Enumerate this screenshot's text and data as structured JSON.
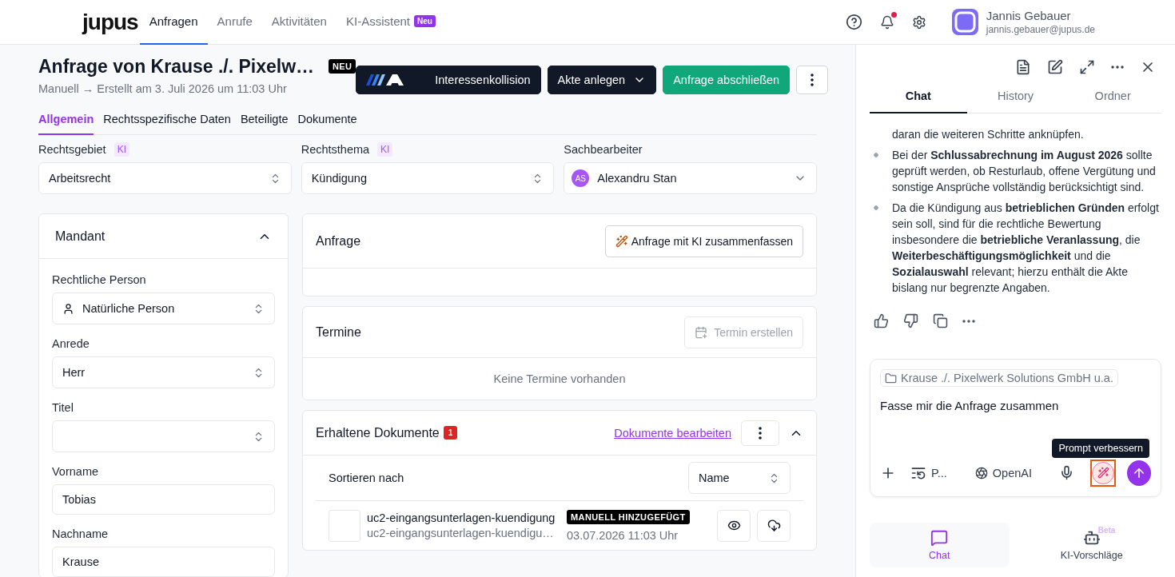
{
  "nav": {
    "logo": "jupus",
    "tabs": [
      {
        "label": "Anfragen",
        "selected": true
      },
      {
        "label": "Anrufe",
        "selected": false
      },
      {
        "label": "Aktivitäten",
        "selected": false
      },
      {
        "label": "KI-Assistent",
        "selected": false,
        "badge": "Neu"
      }
    ],
    "notifications_unread": true,
    "user": {
      "name": "Jannis Gebauer",
      "email": "jannis.gebauer@jupus.de"
    }
  },
  "header": {
    "title": "Anfrage von Krause ./. Pixelw…",
    "badge": "NEU",
    "subtitle": "Manuell → Erstellt am 3. Juli 2026 um 11:03 Uhr",
    "buttons": [
      {
        "kind": "logo",
        "label": "Interessenkollision"
      },
      {
        "kind": "dropdown",
        "label": "Akte anlegen"
      },
      {
        "kind": "primary",
        "label": "Anfrage abschließen"
      },
      {
        "kind": "more"
      }
    ]
  },
  "tabs": [
    {
      "label": "Allgemein",
      "selected": true
    },
    {
      "label": "Rechtsspezifische Daten",
      "selected": false
    },
    {
      "label": "Beteiligte",
      "selected": false
    },
    {
      "label": "Dokumente",
      "selected": false
    }
  ],
  "fields": [
    {
      "label": "Rechtsgebiet",
      "badge": "KI",
      "kind": "select",
      "value": "Arbeitsrecht"
    },
    {
      "label": "Rechtsthema",
      "badge": "KI",
      "kind": "select",
      "value": "Kündigung"
    },
    {
      "label": "Sachbearbeiter",
      "kind": "person",
      "initials": "AS",
      "value": "Alexandru Stan"
    }
  ],
  "mandant": {
    "title": "Mandant",
    "expanded": true,
    "fields": [
      {
        "label": "Rechtliche Person",
        "kind": "person-select",
        "value": "Natürliche Person"
      },
      {
        "label": "Anrede",
        "kind": "select",
        "value": "Herr"
      },
      {
        "label": "Titel",
        "kind": "select"
      },
      {
        "label": "Vorname",
        "kind": "text",
        "value": "Tobias"
      },
      {
        "label": "Nachname",
        "kind": "text",
        "value": "Krause"
      }
    ]
  },
  "anfrage": {
    "title": "Anfrage",
    "button": "Anfrage mit KI zusammenfassen"
  },
  "termine": {
    "title": "Termine",
    "button": {
      "label": "Termin erstellen",
      "disabled": true
    },
    "empty": "Keine Termine vorhanden"
  },
  "dokumente": {
    "title": "Erhaltene Dokumente",
    "count": "1",
    "link": "Dokumente bearbeiten",
    "expanded": true,
    "sort_label": "Sortieren nach",
    "sort_value": "Name",
    "files": [
      {
        "name": "uc2-eingangsunterlagen-kuendigung",
        "subtitle": "uc2-eingangsunterlagen-kuendigu…",
        "badge": "MANUELL HINZUGEFÜGT",
        "date": "03.07.2026 11:03 Uhr"
      }
    ]
  },
  "assistant": {
    "tabs": [
      {
        "label": "Chat",
        "selected": true
      },
      {
        "label": "History",
        "selected": false
      },
      {
        "label": "Ordner",
        "selected": false
      }
    ],
    "messages": [
      {
        "bullet": false,
        "text": "daran die weiteren Schritte anknüpfen."
      },
      {
        "bullet": true,
        "text": "Bei der **Schlussabrechnung im August 2026** sollte geprüft werden, ob Resturlaub, offene Vergütung und sonstige Ansprüche vollständig berücksichtigt sind."
      },
      {
        "bullet": true,
        "text": "Da die Kündigung aus **betrieblichen Gründen** erfolgt sein soll, sind für die rechtliche Bewertung insbesondere die **betriebliche Veranlassung**, die **Weiterbeschäftigungsmöglichkeit** und die **Sozialauswahl** relevant; hierzu enthält die Akte bislang nur begrenzte Angaben."
      }
    ],
    "composer": {
      "context": "Krause ./. Pixelwerk Solutions GmbH u.a.",
      "value": "Fasse mir die Anfrage zusammen",
      "prompt_label": "P...",
      "model": "OpenAI",
      "tooltip": "Prompt verbessern"
    },
    "bottom_tabs": [
      {
        "label": "Chat",
        "selected": true
      },
      {
        "label": "KI-Vorschläge",
        "selected": false,
        "badge": "Beta"
      }
    ]
  }
}
